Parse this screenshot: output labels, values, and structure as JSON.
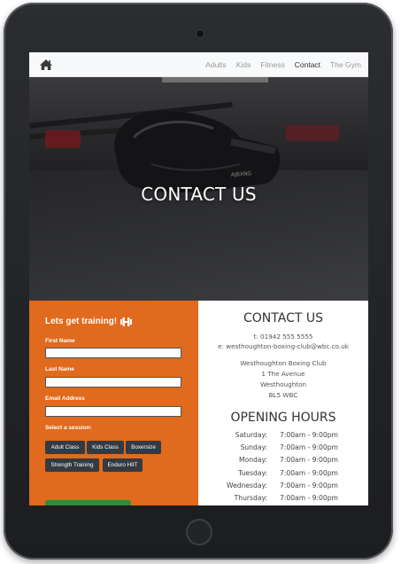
{
  "nav": {
    "home_icon": "home-icon",
    "links": [
      {
        "label": "Adults",
        "active": false
      },
      {
        "label": "Kids",
        "active": false
      },
      {
        "label": "Fitness",
        "active": false
      },
      {
        "label": "Contact",
        "active": true
      },
      {
        "label": "The Gym",
        "active": false
      }
    ]
  },
  "hero": {
    "title": "CONTACT US",
    "glove_text": "AJBXNG"
  },
  "form": {
    "heading": "Lets get training!",
    "heading_icon": "dumbbell-icon",
    "first_name_label": "First Name",
    "last_name_label": "Last Name",
    "email_label": "Email Address",
    "session_label": "Select a session:",
    "sessions": [
      "Adult Class",
      "Kids Class",
      "Boxersize",
      "Strength Training",
      "Enduro HIIT"
    ],
    "accent_color": "#e06a1d",
    "button_color": "#343a40",
    "submit_color": "#2f8a3a"
  },
  "contact": {
    "title": "CONTACT US",
    "phone": "t: 01942 555 5555",
    "email": "e: westhoughton-boxing-club@wbc.co.uk",
    "address": [
      "Westhoughton Boxing Club",
      "1 The Avenue",
      "Westhoughton",
      "BL5 WBC"
    ]
  },
  "hours": {
    "title": "OPENING HOURS",
    "rows": [
      {
        "day": "Saturday:",
        "time": "7:00am - 9:00pm"
      },
      {
        "day": "Sunday:",
        "time": "7:00am - 9:00pm"
      },
      {
        "day": "Monday:",
        "time": "7:00am - 9:00pm"
      },
      {
        "day": "Tuesday:",
        "time": "7:00am - 9:00pm"
      },
      {
        "day": "Wednesday:",
        "time": "7:00am - 9:00pm"
      },
      {
        "day": "Thursday:",
        "time": "7:00am - 9:00pm"
      }
    ]
  }
}
